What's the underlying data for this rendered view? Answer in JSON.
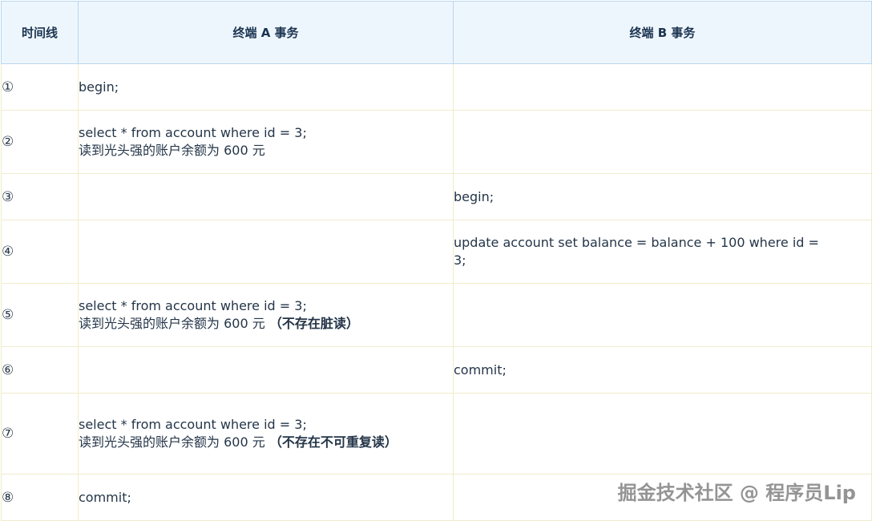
{
  "header": {
    "time_col": "时间线",
    "col_a": "终端 A 事务",
    "col_b": "终端 B 事务"
  },
  "rows": [
    {
      "num": "①",
      "a": [
        "begin;"
      ],
      "a_note": "",
      "b": []
    },
    {
      "num": "②",
      "a": [
        "select * from account where id = 3;",
        "读到光头强的账户余额为 600 元"
      ],
      "a_note": "",
      "b": []
    },
    {
      "num": "③",
      "a": [],
      "a_note": "",
      "b": [
        "begin;"
      ]
    },
    {
      "num": "④",
      "a": [],
      "a_note": "",
      "b": [
        "update account set balance = balance + 100 where id =",
        "3;"
      ]
    },
    {
      "num": "⑤",
      "a": [
        "select * from account where id = 3;",
        "读到光头强的账户余额为 600 元"
      ],
      "a_note": "（不存在脏读）",
      "b": []
    },
    {
      "num": "⑥",
      "a": [],
      "a_note": "",
      "b": [
        "commit;"
      ]
    },
    {
      "num": "⑦",
      "a": [
        "select * from account where id = 3;",
        "读到光头强的账户余额为 600 元"
      ],
      "a_note": "（不存在不可重复读）",
      "b": []
    },
    {
      "num": "⑧",
      "a": [
        "commit;"
      ],
      "a_note": "",
      "b": []
    }
  ],
  "watermark": "掘金技术社区 @ 程序员Lip"
}
